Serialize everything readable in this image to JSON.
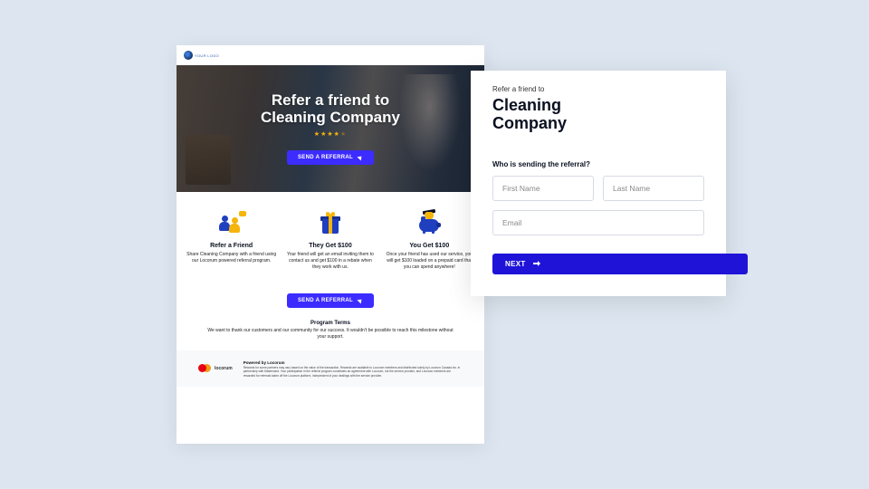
{
  "logo": {
    "text": "YOUR LOGO"
  },
  "hero": {
    "title_line1": "Refer a friend to",
    "title_line2": "Cleaning Company",
    "stars_full": 4,
    "stars_total": 5,
    "cta_label": "SEND A REFERRAL"
  },
  "benefits": [
    {
      "icon": "people-icon",
      "title": "Refer a Friend",
      "desc": "Share Cleaning Company with a friend using our Locorum powered referral program."
    },
    {
      "icon": "gift-icon",
      "title": "They Get $100",
      "desc": "Your friend will get an email inviting them to contact us and get $100 in a rebate when they work with us."
    },
    {
      "icon": "piggy-icon",
      "title": "You Get $100",
      "desc": "Once your friend has used our service, you will get $100 loaded on a prepaid card that you can spend anywhere!"
    }
  ],
  "cta2_label": "SEND A REFERRAL",
  "terms": {
    "title": "Program Terms",
    "desc": "We want to thank our customers and our community for our success. It wouldn't be possible to reach this milestone without your support."
  },
  "footer": {
    "locorum_label": "locorum",
    "heading": "Powered by Locorum",
    "body": "Rewards for some partners may vary based on the value of the transaction. Rewards are available to Locorum members and distributed solely by Locorum Canada Inc. in partnership with Mastercard. Your participation in the referral program constitutes an agreement with Locorum, not the service provider, and Locorum members are rewarded for referrals taken off the Locorum platform, independent of your dealings with the service provider."
  },
  "form": {
    "subtitle": "Refer a friend to",
    "title": "Cleaning Company",
    "question": "Who is sending the referral?",
    "first_name_placeholder": "First Name",
    "last_name_placeholder": "Last Name",
    "email_placeholder": "Email",
    "next_label": "NEXT"
  }
}
